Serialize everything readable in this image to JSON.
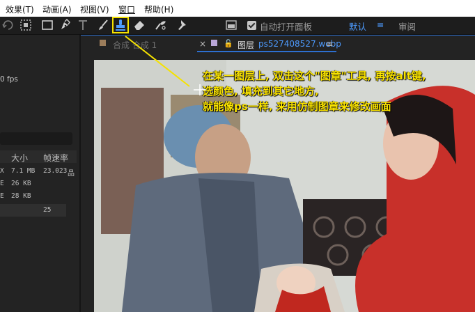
{
  "menubar": {
    "items": [
      "效果(T)",
      "动画(A)",
      "视图(V)",
      "窗口",
      "帮助(H)"
    ]
  },
  "toolbar": {
    "auto_open_panel_label": "自动打开面板",
    "auto_open_panel_checked": true,
    "workspace_default": "默认",
    "workspace_review": "审阅",
    "accent_color": "#4d9bff",
    "selected_tool": "clone-stamp-icon",
    "highlight_color": "#f5e200"
  },
  "left_panel": {
    "fps_label": "0 fps",
    "columns": [
      "大小",
      "帧速率"
    ],
    "rows": [
      {
        "prefix": "X",
        "size": "7.1 MB",
        "rate": "23.023"
      },
      {
        "prefix": "E",
        "size": "26 KB",
        "rate": ""
      },
      {
        "prefix": "E",
        "size": "28 KB",
        "rate": ""
      },
      {
        "prefix": "",
        "size": "",
        "rate": "25"
      }
    ]
  },
  "tabs": {
    "composition_tab": "合成 合成 1",
    "layer_prefix": "图层",
    "layer_name": "ps527408527.webp"
  },
  "annotation": {
    "line1": "在某一图层上, 双击这个\"图章\"工具, 再按alt键,",
    "line2": "选颜色, 填充到其它地方,",
    "line3": "就能像ps一样, 来用仿制图章来修改画面",
    "color": "#fbe400"
  }
}
